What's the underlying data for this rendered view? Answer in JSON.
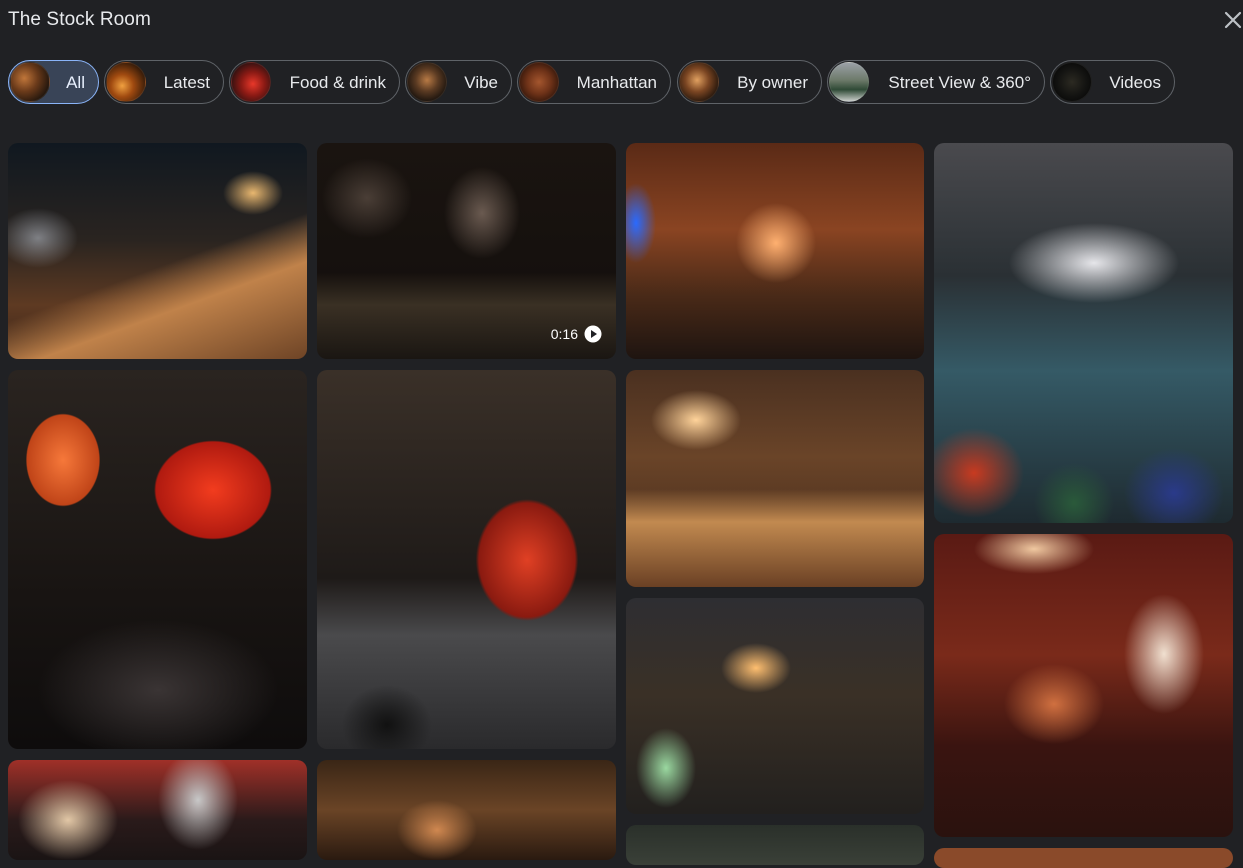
{
  "header": {
    "title": "The Stock Room"
  },
  "chips": [
    {
      "label": "All",
      "selected": true
    },
    {
      "label": "Latest",
      "selected": false
    },
    {
      "label": "Food & drink",
      "selected": false
    },
    {
      "label": "Vibe",
      "selected": false
    },
    {
      "label": "Manhattan",
      "selected": false
    },
    {
      "label": "By owner",
      "selected": false
    },
    {
      "label": "Street View & 360°",
      "selected": false
    },
    {
      "label": "Videos",
      "selected": false
    }
  ],
  "video": {
    "duration": "0:16"
  },
  "icons": {
    "close": "close-icon",
    "play": "play-icon"
  },
  "colors": {
    "background": "#202124",
    "chip_selected_bg": "#394457",
    "chip_selected_border": "#8ab4f8",
    "chip_border": "#5f6368"
  }
}
